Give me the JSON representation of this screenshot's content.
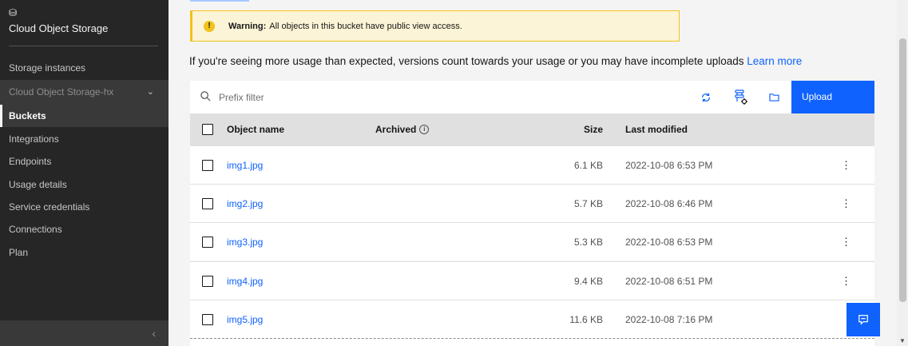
{
  "sidebar": {
    "logo_glyph": "⛁",
    "title": "Cloud Object Storage",
    "storage_instances": "Storage instances",
    "instance_select": "Cloud Object Storage-hx",
    "items": [
      {
        "label": "Buckets",
        "active": true
      },
      {
        "label": "Integrations"
      },
      {
        "label": "Endpoints"
      },
      {
        "label": "Usage details"
      },
      {
        "label": "Service credentials"
      },
      {
        "label": "Connections"
      },
      {
        "label": "Plan"
      }
    ],
    "collapse_glyph": "‹"
  },
  "warning": {
    "icon": "!",
    "bold": "Warning:",
    "text": "All objects in this bucket have public view access."
  },
  "usage_notice": {
    "text": "If you're seeing more usage than expected, versions count towards your usage or you may have incomplete uploads",
    "link": "Learn more"
  },
  "toolbar": {
    "search_placeholder": "Prefix filter",
    "upload_label": "Upload"
  },
  "table": {
    "headers": {
      "name": "Object name",
      "archived": "Archived",
      "archived_info": "i",
      "size": "Size",
      "modified": "Last modified"
    },
    "rows": [
      {
        "name": "img1.jpg",
        "size": "6.1 KB",
        "modified": "2022-10-08 6:53 PM"
      },
      {
        "name": "img2.jpg",
        "size": "5.7 KB",
        "modified": "2022-10-08 6:46 PM"
      },
      {
        "name": "img3.jpg",
        "size": "5.3 KB",
        "modified": "2022-10-08 6:53 PM"
      },
      {
        "name": "img4.jpg",
        "size": "9.4 KB",
        "modified": "2022-10-08 6:51 PM"
      },
      {
        "name": "img5.jpg",
        "size": "11.6 KB",
        "modified": "2022-10-08 7:16 PM"
      }
    ],
    "row_menu_glyph": "⋮"
  },
  "colors": {
    "sidebar_bg": "#262626",
    "accent": "#0f62fe",
    "warning": "#f1c21b",
    "warning_bg": "#fcf4d6"
  }
}
